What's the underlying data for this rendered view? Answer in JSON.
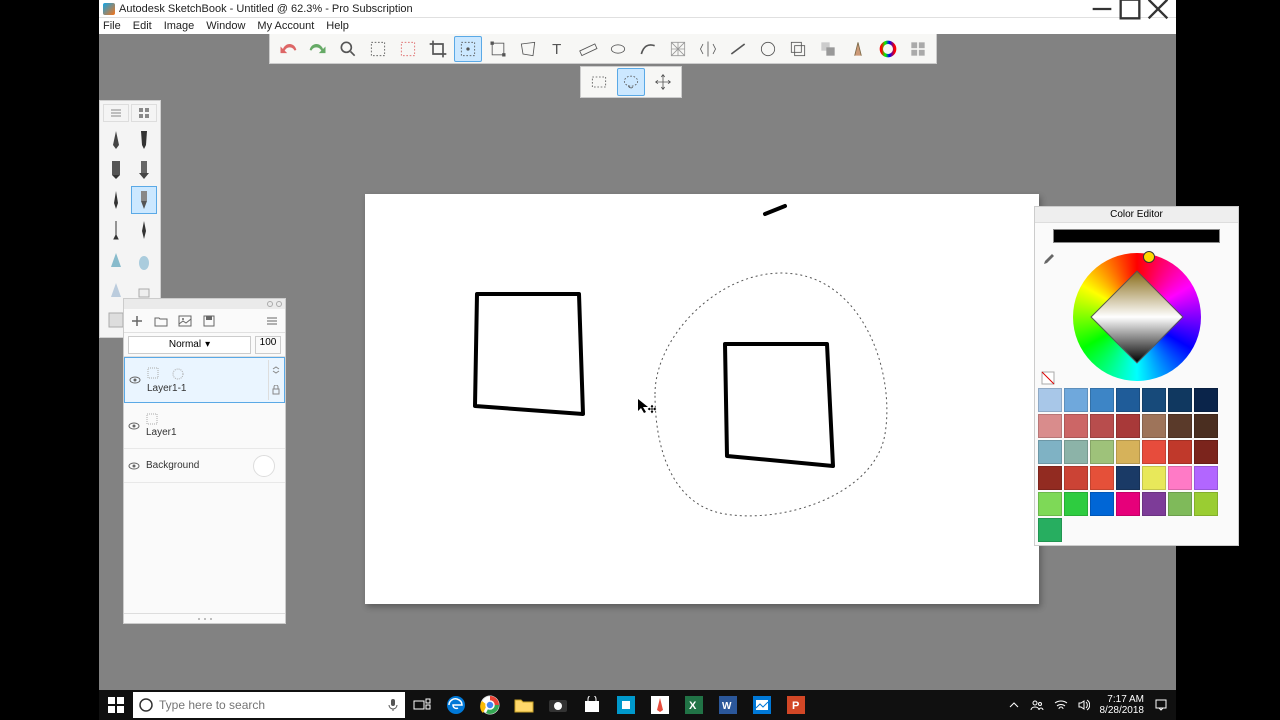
{
  "window": {
    "title": "Autodesk SketchBook - Untitled @ 62.3% - Pro Subscription"
  },
  "menu": {
    "file": "File",
    "edit": "Edit",
    "image": "Image",
    "window": "Window",
    "myaccount": "My Account",
    "help": "Help"
  },
  "layers": {
    "blendmode": "Normal",
    "opacity": "100",
    "items": [
      {
        "name": "Layer1-1"
      },
      {
        "name": "Layer1"
      },
      {
        "name": "Background"
      }
    ]
  },
  "coloreditor": {
    "title": "Color Editor",
    "swatches": [
      [
        "#a8c7e8",
        "#6fa8dc",
        "#3d85c6",
        "#1f5c99",
        "#174a7a",
        "#103860"
      ],
      [
        "#0a244a",
        "#d98c8c",
        "#cc6666",
        "#b84d4d",
        "#a83939",
        "#9e745a"
      ],
      [
        "#5a3a2a",
        "#4a2e20",
        "#7fb2c4",
        "#8cb3a8",
        "#9ec27a",
        "#d6b25a"
      ],
      [
        "#e74c3c",
        "#c0392b",
        "#7b241c",
        "#922b21",
        "#cb4335",
        "#e55039"
      ],
      [
        "#1a3a66",
        "#e8e85a",
        "#ff7ac6",
        "#b266ff",
        "#7ed957",
        "#2ecc40"
      ],
      [
        "#0066d6",
        "#e6007a",
        "#7d3c98",
        "#7fba5a",
        "#9acd32",
        "#27ae60"
      ]
    ]
  },
  "search": {
    "placeholder": "Type here to search"
  },
  "clock": {
    "time": "7:17 AM",
    "date": "8/28/2018"
  }
}
